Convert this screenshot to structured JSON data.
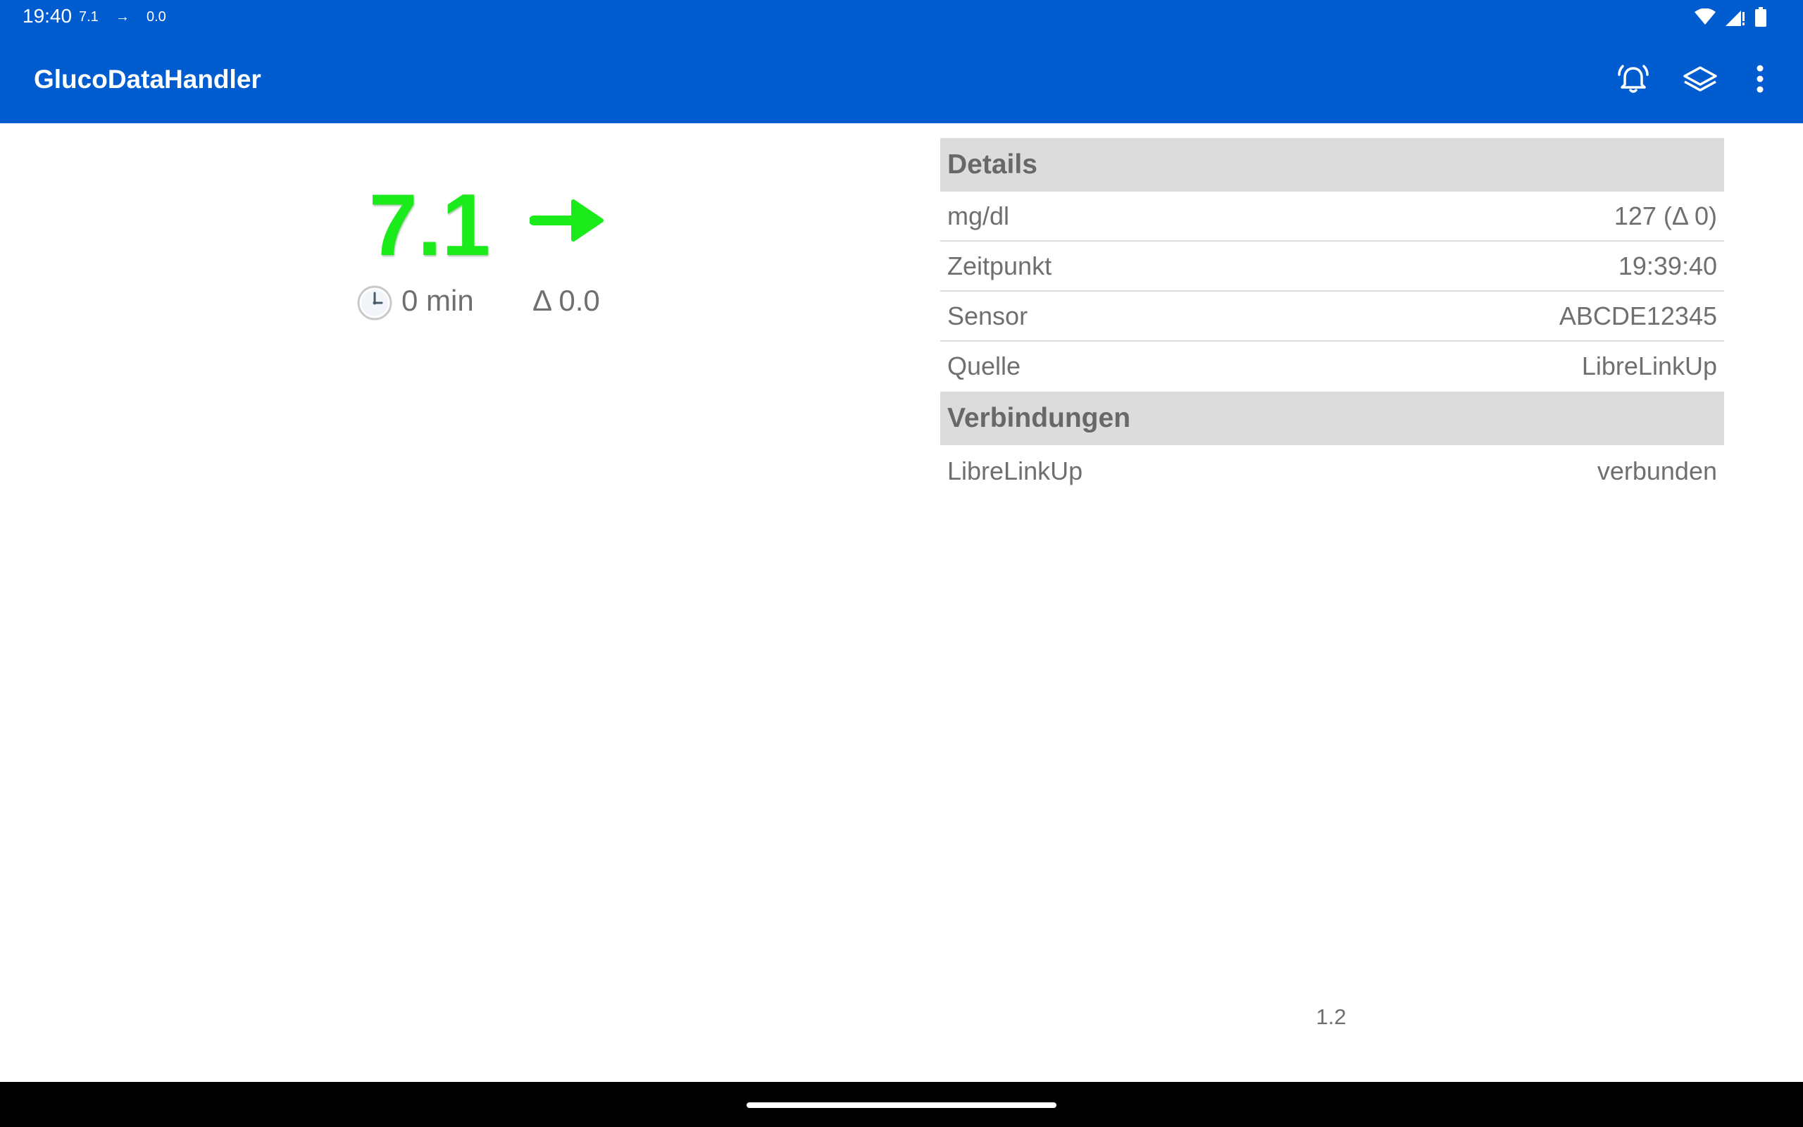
{
  "status_bar": {
    "time": "19:40",
    "glucose": "7.1",
    "trend": "→",
    "delta": "0.0",
    "icons": [
      "wifi-icon",
      "signal-icon",
      "battery-icon"
    ]
  },
  "app_bar": {
    "title": "GlucoDataHandler",
    "actions": [
      "alarm-bell-icon",
      "layers-icon",
      "more-vert-icon"
    ]
  },
  "glucose": {
    "value": "7.1",
    "trend_arrow": "→",
    "age": "0 min",
    "delta": "Δ 0.0",
    "clock_icon": "clock-icon"
  },
  "details": {
    "title": "Details",
    "rows": [
      {
        "label": "mg/dl",
        "value": "127 (Δ 0)"
      },
      {
        "label": "Zeitpunkt",
        "value": "19:39:40"
      },
      {
        "label": "Sensor",
        "value": "ABCDE12345"
      },
      {
        "label": "Quelle",
        "value": "LibreLinkUp"
      }
    ]
  },
  "connections": {
    "title": "Verbindungen",
    "rows": [
      {
        "label": "LibreLinkUp",
        "value": "verbunden"
      }
    ]
  },
  "version": "1.2",
  "colors": {
    "primary": "#005ccf",
    "glucose_ok": "#1bea1b",
    "section_bg": "#dcdcdc",
    "text": "#6f6f6f"
  }
}
